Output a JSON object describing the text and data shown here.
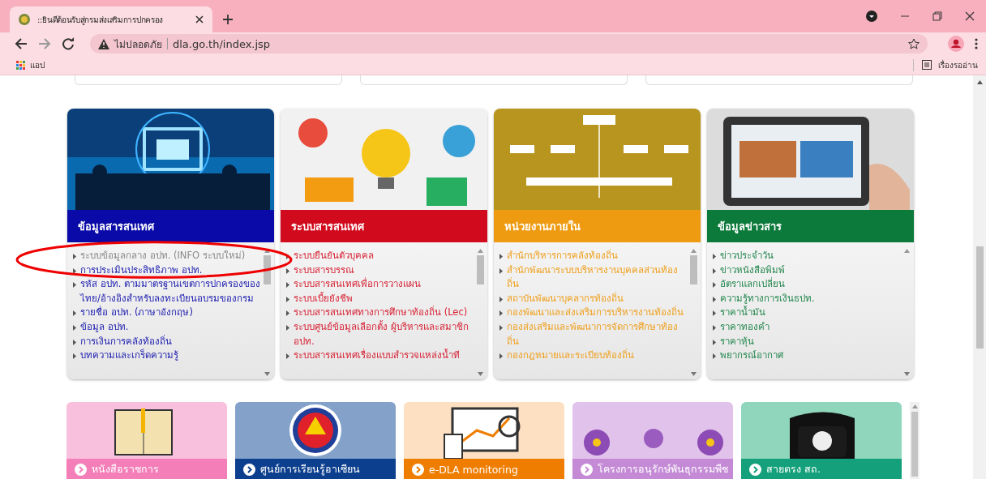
{
  "browser": {
    "tab_title": "::ยินดีต้อนรับสู่กรมส่งเสริมการปกครอง",
    "security_label": "ไม่ปลอดภัย",
    "url": "dla.go.th/index.jsp",
    "bookmarks": [
      {
        "label": "แอป"
      }
    ],
    "reading_list": "เรื่องรออ่าน"
  },
  "cards": [
    {
      "title": "ข้อมูลสารสนเทศ",
      "color": "#0a0aa8",
      "items": [
        {
          "label": "ระบบข้อมูลกลาง อปท. (INFO ระบบใหม่)",
          "hovered": true
        },
        {
          "label": "การประเมินประสิทธิภาพ อปท.",
          "hovered": false
        },
        {
          "label": "รหัส อปท. ตามมาตรฐานเขตการปกครองของไทย/อ้างอิงสำหรับลงทะเบียนอบรมของกรม",
          "hovered": false
        },
        {
          "label": "รายชื่อ อปท. (ภาษาอังกฤษ)",
          "hovered": false
        },
        {
          "label": "ข้อมูล อปท.",
          "hovered": false
        },
        {
          "label": "การเงินการคลังท้องถิ่น",
          "hovered": false
        },
        {
          "label": "บทความและเกร็ดความรู้",
          "hovered": false
        }
      ]
    },
    {
      "title": "ระบบสารสนเทศ",
      "color": "#d20a1e",
      "items": [
        {
          "label": "ระบบยืนยันตัวบุคคล",
          "hovered": false
        },
        {
          "label": "ระบบสารบรรณ",
          "hovered": false
        },
        {
          "label": "ระบบสารสนเทศเพื่อการวางแผน",
          "hovered": false
        },
        {
          "label": "ระบบเบี้ยยังชีพ",
          "hovered": false
        },
        {
          "label": "ระบบสารสนเทศทางการศึกษาท้องถิ่น (Lec)",
          "hovered": false
        },
        {
          "label": "ระบบศูนย์ข้อมูลเลือกตั้ง ผู้บริหารและสมาชิก อปท.",
          "hovered": false
        },
        {
          "label": "ระบบสารสนเทศเรื่องแบบสำรวจแหล่งน้ำที",
          "hovered": false
        }
      ]
    },
    {
      "title": "หน่วยงานภายใน",
      "color": "#ee9b12",
      "items": [
        {
          "label": "สำนักบริหารการคลังท้องถิ่น",
          "hovered": false
        },
        {
          "label": "สำนักพัฒนาระบบบริหารงานบุคคลส่วนท้องถิ่น",
          "hovered": false
        },
        {
          "label": "สถาบันพัฒนาบุคลากรท้องถิ่น",
          "hovered": false
        },
        {
          "label": "กองพัฒนาและส่งเสริมการบริหารงานท้องถิ่น",
          "hovered": false
        },
        {
          "label": "กองส่งเสริมและพัฒนาการจัดการศึกษาท้องถิ่น",
          "hovered": false
        },
        {
          "label": "กองกฎหมายและระเบียบท้องถิ่น",
          "hovered": false
        }
      ]
    },
    {
      "title": "ข้อมูลข่าวสาร",
      "color": "#0b7a3a",
      "items": [
        {
          "label": "ข่าวประจำวัน",
          "hovered": false
        },
        {
          "label": "ข่าวหนังสือพิมพ์",
          "hovered": false
        },
        {
          "label": "อัตราแลกเปลี่ยน",
          "hovered": false
        },
        {
          "label": "ความรู้ทางการเงินธปท.",
          "hovered": false
        },
        {
          "label": "ราคาน้ำมัน",
          "hovered": false
        },
        {
          "label": "ราคาทองคำ",
          "hovered": false
        },
        {
          "label": "ราคาหุ้น",
          "hovered": false
        },
        {
          "label": "พยากรณ์อากาศ",
          "hovered": false
        }
      ]
    }
  ],
  "tiles": [
    {
      "label": "หนังสือราชการ",
      "color": "#f47eb8"
    },
    {
      "label": "ศูนย์การเรียนรู้อาเซียน",
      "color": "#0c3f8e"
    },
    {
      "label": "e-DLA monitoring",
      "color": "#ef7d00"
    },
    {
      "label": "โครงการอนุรักษ์พันธุกรรมพืช",
      "color": "#c48ad6"
    },
    {
      "label": "สายตรง สถ.",
      "color": "#13a07a"
    }
  ]
}
